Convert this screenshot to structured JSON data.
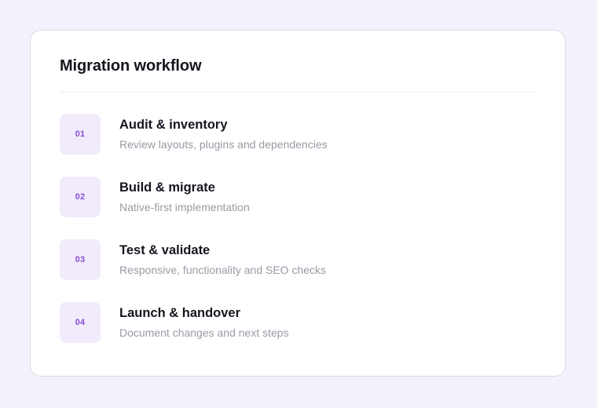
{
  "card": {
    "title": "Migration workflow"
  },
  "steps": [
    {
      "number": "01",
      "title": "Audit & inventory",
      "description": "Review layouts, plugins and dependencies"
    },
    {
      "number": "02",
      "title": "Build & migrate",
      "description": "Native-first implementation"
    },
    {
      "number": "03",
      "title": "Test & validate",
      "description": "Responsive, functionality and SEO checks"
    },
    {
      "number": "04",
      "title": "Launch & handover",
      "description": "Document changes and next steps"
    }
  ],
  "colors": {
    "background": "#f4f1fc",
    "card": "#ffffff",
    "badge_bg": "#f1ebfb",
    "badge_text": "#8a4ed1",
    "title_text": "#15151f",
    "muted_text": "#9a9aa6"
  }
}
